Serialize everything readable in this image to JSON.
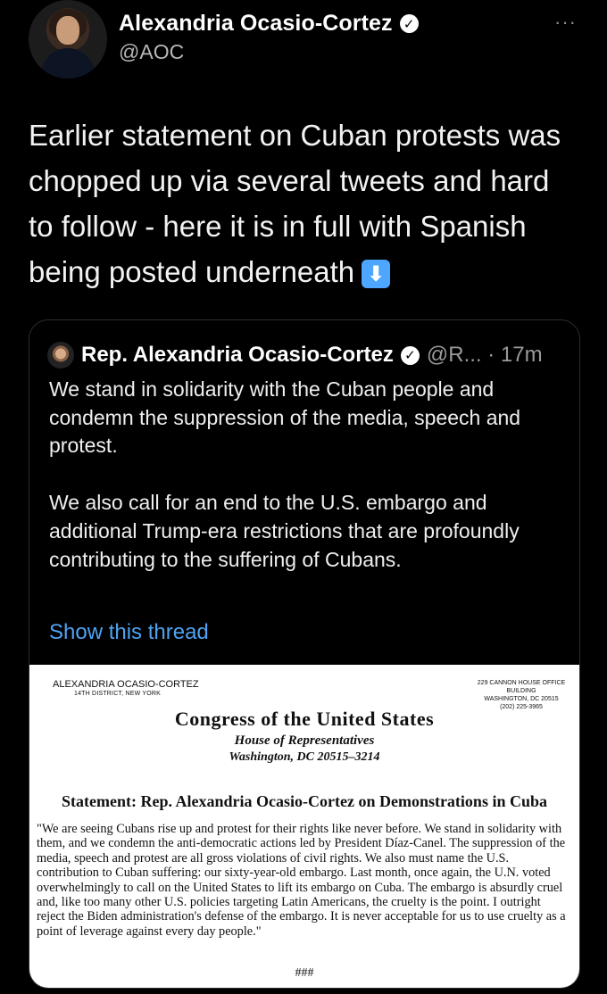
{
  "author": {
    "name": "Alexandria Ocasio-Cortez",
    "handle": "@AOC",
    "verified": "✓"
  },
  "more_label": "···",
  "tweet": {
    "text": "Earlier statement on Cuban protests was chopped up via several tweets and hard to follow - here it is in full with Spanish being posted underneath",
    "emoji": "⬇"
  },
  "quote": {
    "author_name": "Rep. Alexandria Ocasio-Cortez",
    "verified": "✓",
    "handle_time": "@R... · 17m",
    "paragraph_1": "We stand in solidarity with the Cuban people and condemn the suppression of the media, speech and protest.",
    "paragraph_2": "We also call for an end to the U.S. embargo and additional Trump-era restrictions that are profoundly contributing to the suffering of Cubans.",
    "show_thread": "Show this thread",
    "letter": {
      "name": "ALEXANDRIA OCASIO-CORTEZ",
      "district": "14TH DISTRICT, NEW YORK",
      "office_1": "229 CANNON HOUSE OFFICE BUILDING",
      "office_2": "WASHINGTON, DC 20515",
      "office_3": "(202) 225-3965",
      "congress": "Congress of the United States",
      "house": "House of Representatives",
      "address": "Washington, DC 20515–3214",
      "statement_title": "Statement: Rep. Alexandria Ocasio-Cortez on Demonstrations in Cuba",
      "statement_body": "\"We are seeing Cubans rise up and protest for their rights like never before. We stand in solidarity with them, and we condemn the anti-democratic actions led by President Díaz-Canel. The suppression of the media, speech and protest are all gross violations of civil rights. We also must name the U.S. contribution to Cuban suffering: our sixty-year-old embargo. Last month, once again, the U.N. voted overwhelmingly to call on the United States to lift its embargo on Cuba. The embargo is absurdly cruel and, like too many other U.S. policies targeting Latin Americans, the cruelty is the point. I outright reject the Biden administration's defense of the embargo. It is never acceptable for us to use cruelty as a point of leverage against every day people.\"",
      "end_mark": "###"
    }
  }
}
